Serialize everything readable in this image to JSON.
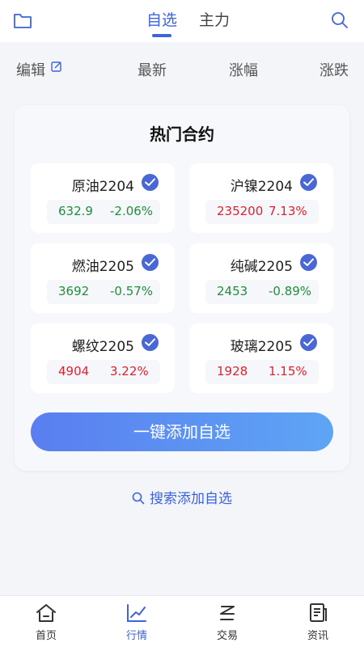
{
  "header": {
    "tabs": [
      {
        "label": "自选",
        "active": true
      },
      {
        "label": "主力",
        "active": false
      }
    ],
    "icons": {
      "left": "folder-icon",
      "right": "search-icon"
    }
  },
  "columns": {
    "edit_label": "编辑",
    "latest": "最新",
    "change_pct": "涨幅",
    "change_amt": "涨跌"
  },
  "hot": {
    "title": "热门合约",
    "contracts": [
      {
        "name": "原油2204",
        "price": "632.9",
        "change": "-2.06%",
        "direction": "down",
        "selected": true
      },
      {
        "name": "沪镍2204",
        "price": "235200",
        "change": "7.13%",
        "direction": "up",
        "selected": true
      },
      {
        "name": "燃油2205",
        "price": "3692",
        "change": "-0.57%",
        "direction": "down",
        "selected": true
      },
      {
        "name": "纯碱2205",
        "price": "2453",
        "change": "-0.89%",
        "direction": "down",
        "selected": true
      },
      {
        "name": "螺纹2205",
        "price": "4904",
        "change": "3.22%",
        "direction": "up",
        "selected": true
      },
      {
        "name": "玻璃2205",
        "price": "1928",
        "change": "1.15%",
        "direction": "up",
        "selected": true
      }
    ],
    "add_button": "一键添加自选"
  },
  "search_add": "搜索添加自选",
  "nav": [
    {
      "label": "首页",
      "icon": "home-icon",
      "active": false
    },
    {
      "label": "行情",
      "icon": "chart-icon",
      "active": true
    },
    {
      "label": "交易",
      "icon": "trade-icon",
      "active": false
    },
    {
      "label": "资讯",
      "icon": "news-icon",
      "active": false
    }
  ],
  "colors": {
    "accent": "#3d63dd",
    "up": "#e0222f",
    "down": "#1f8f3a"
  }
}
